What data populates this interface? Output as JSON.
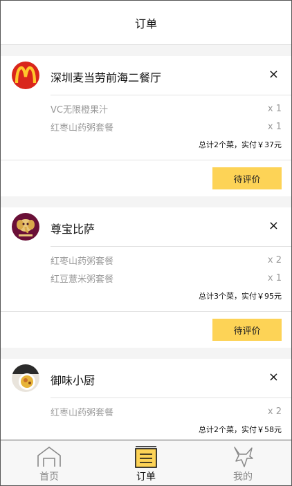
{
  "header": {
    "title": "订单"
  },
  "orders": [
    {
      "shop_name": "深圳麦当劳前海二餐厅",
      "logo": "mcdonalds-logo",
      "items": [
        {
          "name": "VC无限橙果汁",
          "qty": "x 1"
        },
        {
          "name": "红枣山药粥套餐",
          "qty": "x 1"
        }
      ],
      "summary": "总计2个菜，实付￥37元",
      "action_label": "待评价"
    },
    {
      "shop_name": "尊宝比萨",
      "logo": "zunbao-pizza-logo",
      "items": [
        {
          "name": "红枣山药粥套餐",
          "qty": "x 2"
        },
        {
          "name": "红豆薏米粥套餐",
          "qty": "x 1"
        }
      ],
      "summary": "总计3个菜，实付￥95元",
      "action_label": "待评价"
    },
    {
      "shop_name": "御味小厨",
      "logo": "yuwei-kitchen-logo",
      "items": [
        {
          "name": "红枣山药粥套餐",
          "qty": "x 2"
        }
      ],
      "summary": "总计2个菜，实付￥58元"
    }
  ],
  "icons": {
    "close": "×"
  },
  "tabbar": [
    {
      "label": "首页",
      "icon": "home-icon",
      "active": false
    },
    {
      "label": "订单",
      "icon": "order-icon",
      "active": true
    },
    {
      "label": "我的",
      "icon": "profile-icon",
      "active": false
    }
  ],
  "colors": {
    "accent": "#fdd356",
    "mcd_red": "#d9261c",
    "mcd_yellow": "#ffc72c",
    "zunbao": "#6a1037"
  }
}
